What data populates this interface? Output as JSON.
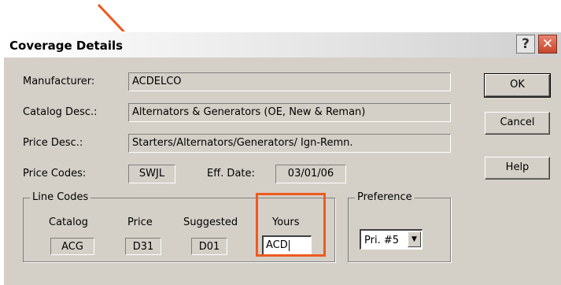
{
  "window": {
    "title": "Coverage Details",
    "help_glyph": "?",
    "close_glyph": "✕"
  },
  "fields": {
    "manufacturer": {
      "label": "Manufacturer:",
      "value": "ACDELCO"
    },
    "catalog_desc": {
      "label": "Catalog Desc.:",
      "value": "Alternators & Generators (OE, New & Reman)"
    },
    "price_desc": {
      "label": "Price Desc.:",
      "value": "Starters/Alternators/Generators/ Ign-Remn."
    },
    "price_codes": {
      "label": "Price Codes:",
      "value": "SWJL"
    },
    "eff_date": {
      "label": "Eff. Date:",
      "value": "03/01/06"
    }
  },
  "buttons": {
    "ok": "OK",
    "cancel": "Cancel",
    "help": "Help"
  },
  "line_codes": {
    "legend": "Line Codes",
    "catalog": {
      "label": "Catalog",
      "value": "ACG"
    },
    "price": {
      "label": "Price",
      "value": "D31"
    },
    "suggested": {
      "label": "Suggested",
      "value": "D01"
    },
    "yours": {
      "label": "Yours",
      "value": "ACD"
    }
  },
  "preference": {
    "legend": "Preference",
    "selected": "Pri. #5",
    "arrow_glyph": "▼"
  },
  "annotation": {
    "color": "#ee5a1e"
  }
}
